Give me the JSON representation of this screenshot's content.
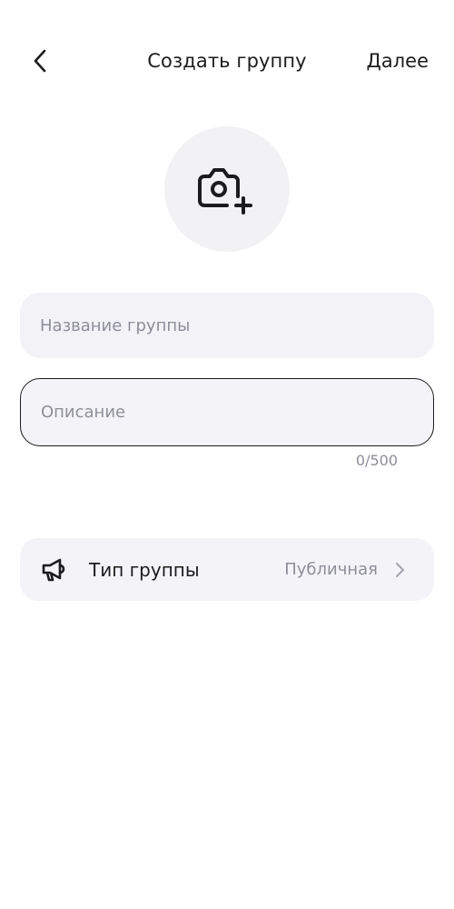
{
  "header": {
    "title": "Создать группу",
    "next_label": "Далее"
  },
  "avatar": {
    "icon": "camera-plus-icon"
  },
  "form": {
    "name_placeholder": "Название группы",
    "name_value": "",
    "description_placeholder": "Описание",
    "description_value": "",
    "description_counter": "0/500"
  },
  "group_type": {
    "icon": "megaphone-icon",
    "label": "Тип группы",
    "value": "Публичная"
  },
  "colors": {
    "text": "#1c1c1e",
    "muted": "#8e8e99",
    "field_bg": "#f2f2f7"
  }
}
